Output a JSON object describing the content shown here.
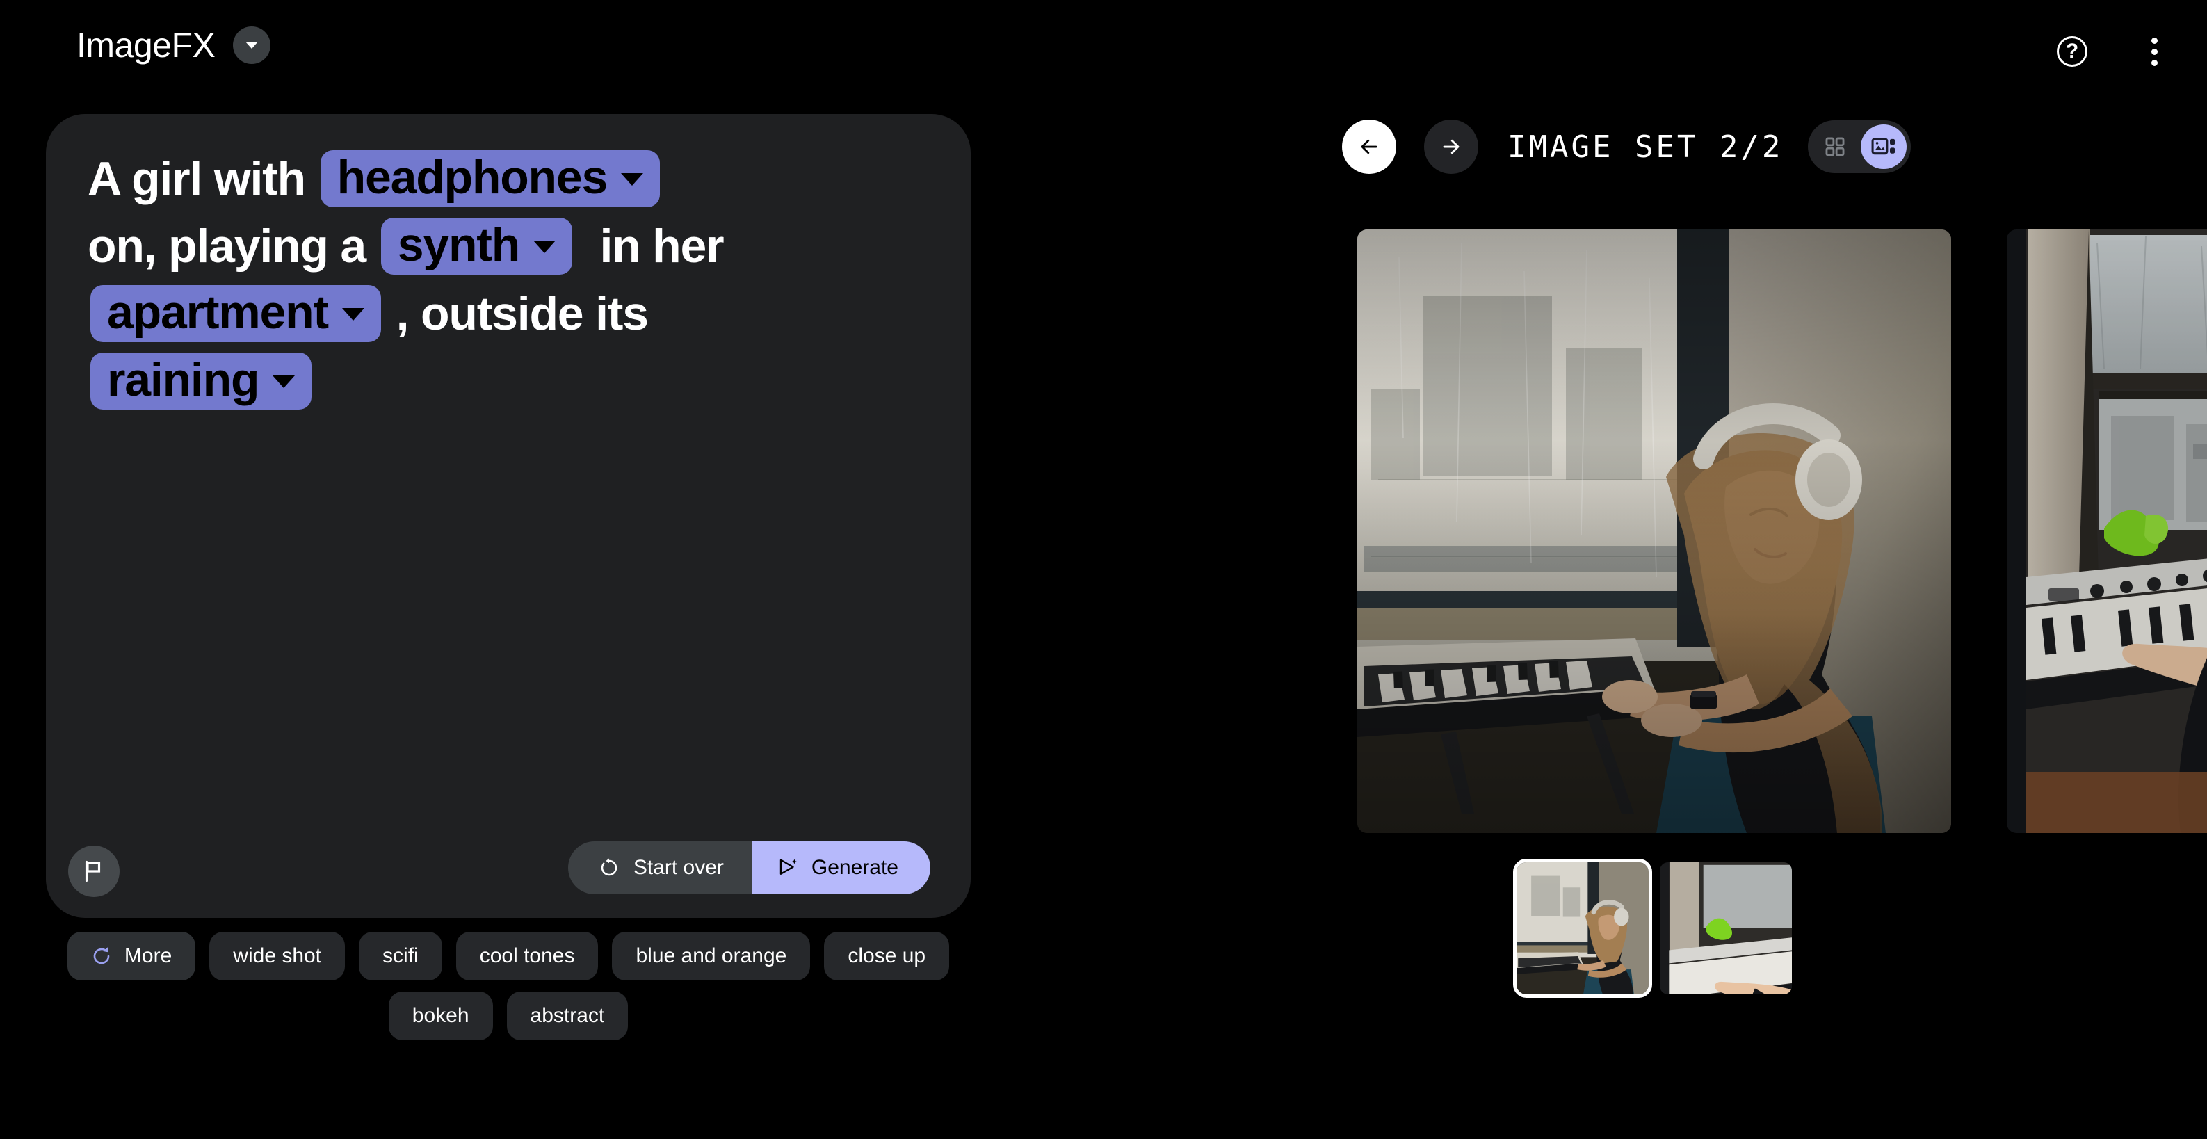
{
  "app": {
    "title": "ImageFX",
    "brand_dropdown_icon": "chevron-down-icon",
    "help_icon": "help-circle-icon",
    "menu_icon": "more-vertical-icon"
  },
  "prompt": {
    "lines": [
      [
        {
          "type": "text",
          "value": "A girl with "
        },
        {
          "type": "chip",
          "value": "headphones"
        }
      ],
      [
        {
          "type": "text",
          "value": "on, playing a "
        },
        {
          "type": "chip",
          "value": "synth"
        },
        {
          "type": "text",
          "value": "  in her"
        }
      ],
      [
        {
          "type": "chip",
          "value": "apartment"
        },
        {
          "type": "text",
          "value": " , outside its"
        }
      ],
      [
        {
          "type": "chip",
          "value": "raining"
        }
      ]
    ],
    "full_text": "A girl with headphones on, playing a synth in her apartment , outside its raining",
    "flag_icon": "flag-icon",
    "start_over_label": "Start over",
    "start_over_icon": "restart-icon",
    "generate_label": "Generate",
    "generate_icon": "send-sparkle-icon",
    "chip_color": "#7379CE",
    "generate_color": "#B6B9FB"
  },
  "suggestions": {
    "row1": [
      {
        "label": "More",
        "icon": "refresh-icon",
        "is_more": true
      },
      {
        "label": "wide shot",
        "icon": "",
        "is_more": false
      },
      {
        "label": "scifi",
        "icon": "",
        "is_more": false
      },
      {
        "label": "cool tones",
        "icon": "",
        "is_more": false
      },
      {
        "label": "blue and orange",
        "icon": "",
        "is_more": false
      },
      {
        "label": "close up",
        "icon": "",
        "is_more": false
      }
    ],
    "row2": [
      {
        "label": "bokeh",
        "icon": "",
        "is_more": false
      },
      {
        "label": "abstract",
        "icon": "",
        "is_more": false
      }
    ]
  },
  "gallery": {
    "prev_icon": "arrow-left-icon",
    "next_icon": "arrow-right-icon",
    "set_label": "IMAGE SET 2/2",
    "view_grid_icon": "grid-view-icon",
    "view_detail_icon": "detail-view-icon",
    "active_view": "detail",
    "images": [
      {
        "alt": "girl with headphones playing synth by rainy window, selected",
        "selected": true
      },
      {
        "alt": "girl with headphones at synth keyboard near window with green plant",
        "selected": false
      }
    ],
    "actions": [
      {
        "icon": "tune-icon",
        "name": "tune-button"
      },
      {
        "icon": "download-icon",
        "name": "download-button"
      },
      {
        "icon": "share-icon",
        "name": "share-button"
      }
    ]
  }
}
